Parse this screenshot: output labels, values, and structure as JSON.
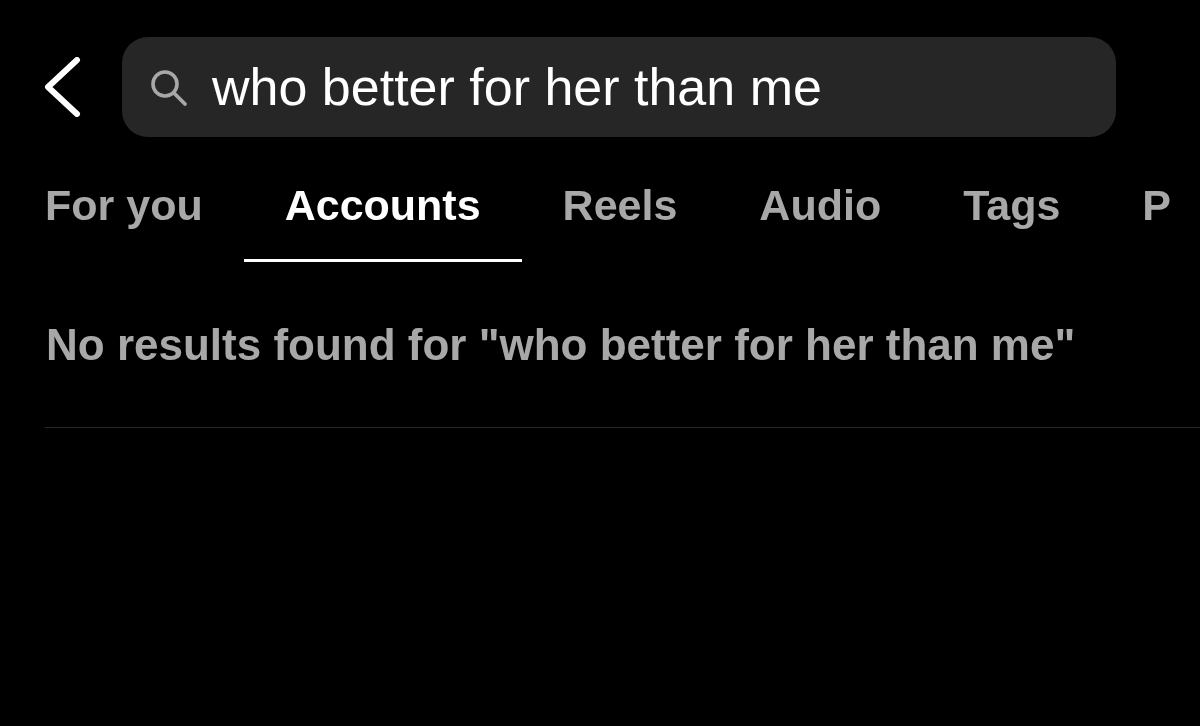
{
  "search": {
    "value": "who better for her than me"
  },
  "tabs": [
    {
      "label": "For you",
      "selected": false
    },
    {
      "label": "Accounts",
      "selected": true
    },
    {
      "label": "Reels",
      "selected": false
    },
    {
      "label": "Audio",
      "selected": false
    },
    {
      "label": "Tags",
      "selected": false
    },
    {
      "label": "P",
      "selected": false
    }
  ],
  "message": "No results found for \"who better for her than me\""
}
